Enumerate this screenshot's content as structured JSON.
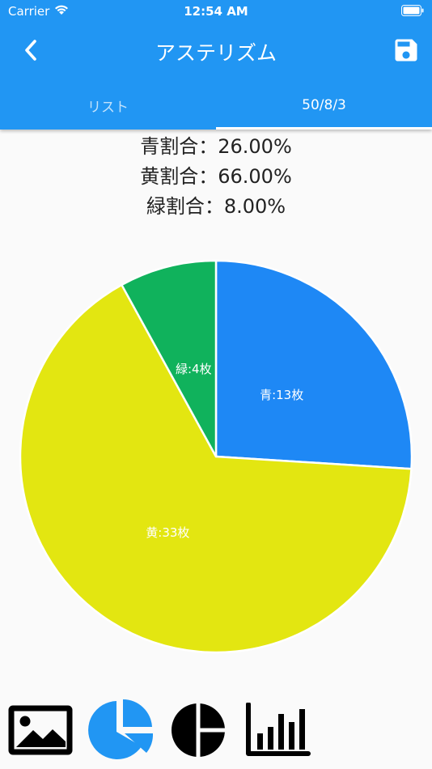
{
  "status_bar": {
    "carrier": "Carrier",
    "time": "12:54 AM"
  },
  "header": {
    "title": "アステリズム"
  },
  "tabs": [
    {
      "label": "リスト"
    },
    {
      "label": "50/8/3"
    }
  ],
  "stats": [
    {
      "text": "青割合：26.00%"
    },
    {
      "text": "黄割合：66.00%"
    },
    {
      "text": "緑割合：8.00%"
    }
  ],
  "colors": {
    "appbar": "#2196f3",
    "blue": "#1e88f5",
    "yellow": "#e3e611",
    "green": "#10b25c",
    "nav_active": "#2196f3",
    "nav_inactive": "#000000"
  },
  "chart_data": {
    "type": "pie",
    "start": "12 o'clock",
    "direction": "clockwise",
    "slices": [
      {
        "label": "青:13枚",
        "value": 13,
        "color": "#1e88f5"
      },
      {
        "label": "黄:33枚",
        "value": 33,
        "color": "#e3e611"
      },
      {
        "label": "緑:4枚",
        "value": 4,
        "color": "#10b25c"
      }
    ]
  },
  "bottom_nav": {
    "items": [
      {
        "icon": "image-icon",
        "active": false
      },
      {
        "icon": "pie-chart-icon",
        "active": true
      },
      {
        "icon": "pie-chart-alt-icon",
        "active": false
      },
      {
        "icon": "bar-chart-icon",
        "active": false
      }
    ]
  }
}
